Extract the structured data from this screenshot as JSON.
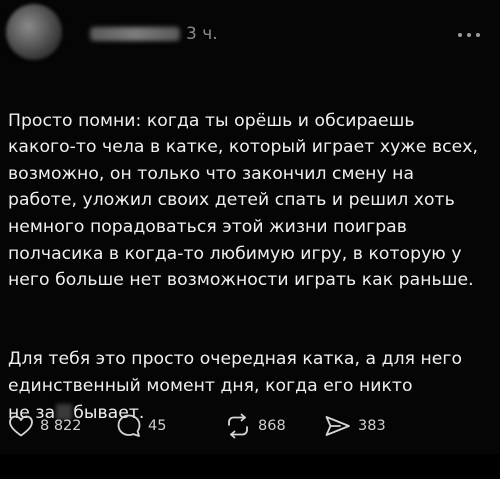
{
  "header": {
    "time": "3 ч."
  },
  "post": {
    "paragraph1": "Просто помни: когда ты орёшь и обсираешь\nкакого-то чела в катке, который играет хуже всех,\nвозможно, он только что закончил смену на\nработе, уложил своих детей спать и решил хоть\nнемного порадоваться этой жизни поиграв\nполчасика в когда-то любимую игру, в которую у\nнего больше нет возможности играть как раньше.",
    "paragraph2_part1": "Для тебя это просто очередная катка, а для него\nединственный момент дня, когда его никто\nне за",
    "paragraph2_part2": "бывает."
  },
  "actions": {
    "likes": "8 822",
    "comments": "45",
    "reposts": "868",
    "shares": "383"
  },
  "icons": {
    "like": "heart-icon",
    "comment": "comment-bubble-icon",
    "repost": "repost-arrows-icon",
    "share": "send-paper-plane-icon",
    "more": "more-dots-icon"
  }
}
